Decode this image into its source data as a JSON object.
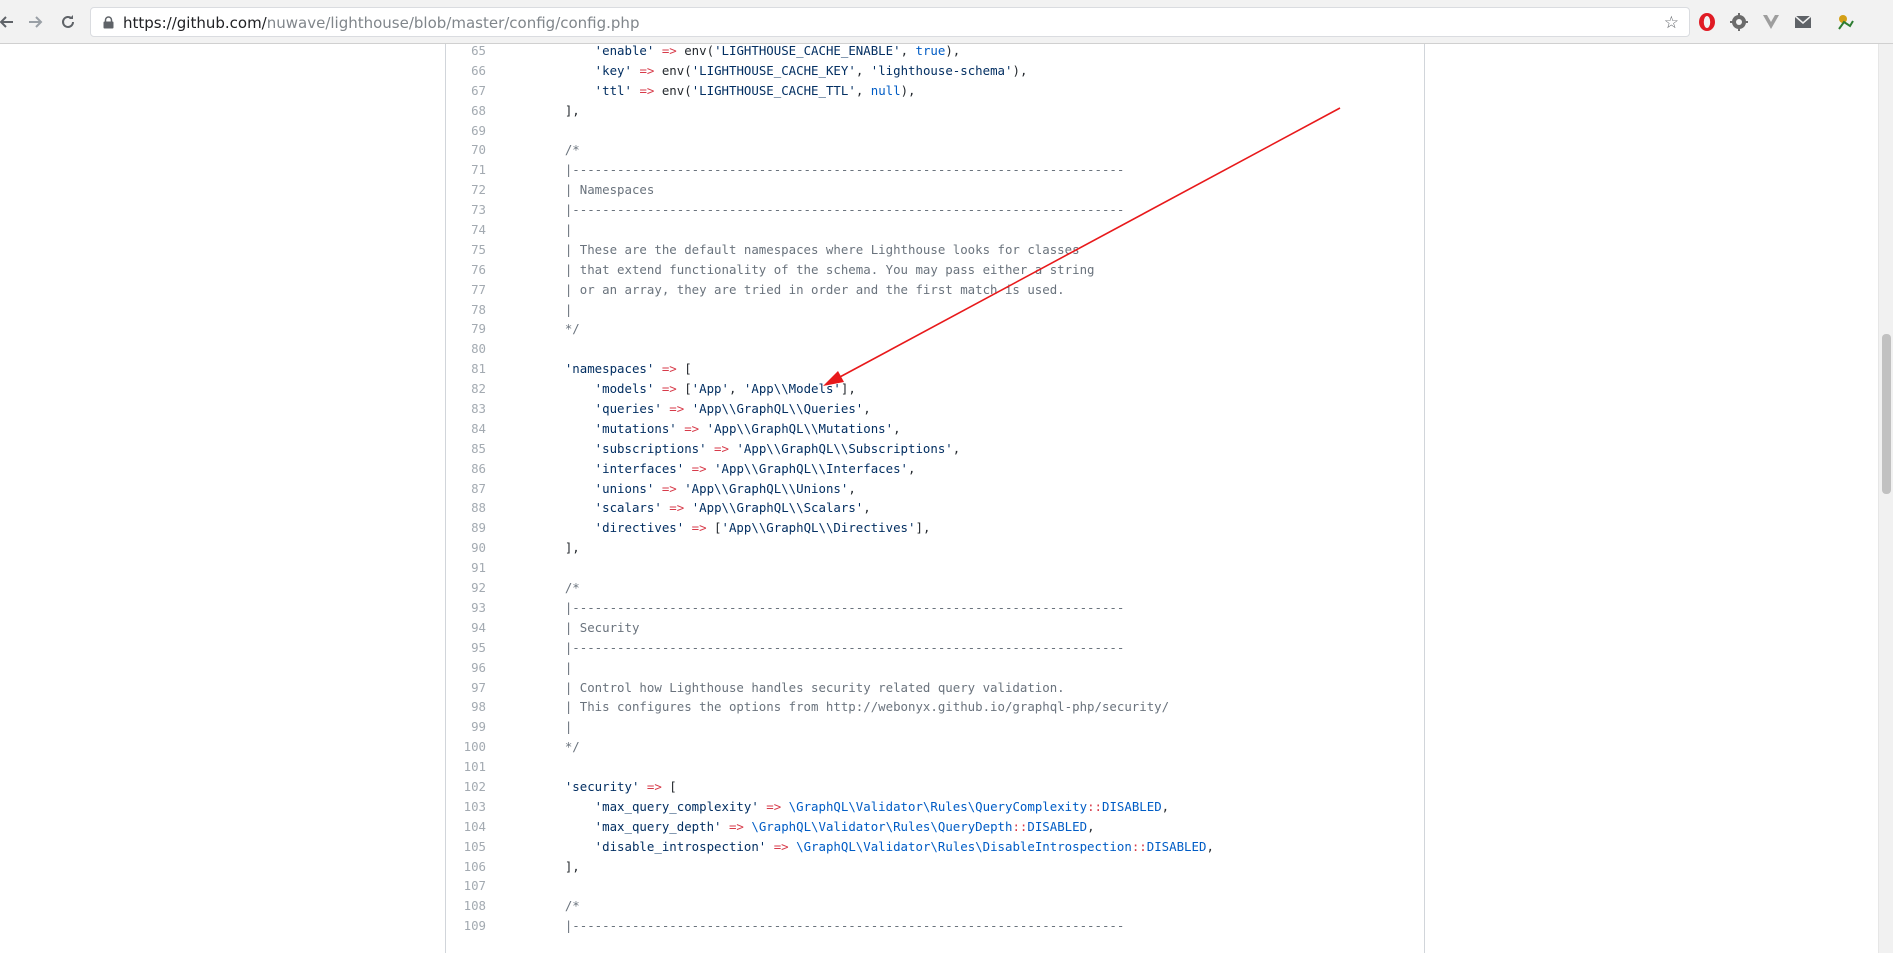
{
  "browser": {
    "url_host": "https://github.com/",
    "url_path": "nuwave/lighthouse/blob/master/config/config.php",
    "icons": [
      "back-icon",
      "forward-icon",
      "reload-icon",
      "lock-icon",
      "star-icon",
      "opera-icon",
      "gear-icon",
      "vivaldi-icon",
      "mail-icon",
      "extension-icon"
    ]
  },
  "code": {
    "lines": [
      {
        "n": "65",
        "tokens": [
          [
            "s",
            "        'enable'"
          ],
          [
            "o",
            " =>"
          ],
          [
            "p",
            " env("
          ],
          [
            "s",
            "'LIGHTHOUSE_CACHE_ENABLE'"
          ],
          [
            "p",
            ", "
          ],
          [
            "c",
            "true"
          ],
          [
            "p",
            "),"
          ]
        ]
      },
      {
        "n": "66",
        "tokens": [
          [
            "s",
            "        'key'"
          ],
          [
            "o",
            " =>"
          ],
          [
            "p",
            " env("
          ],
          [
            "s",
            "'LIGHTHOUSE_CACHE_KEY'"
          ],
          [
            "p",
            ", "
          ],
          [
            "s",
            "'lighthouse-schema'"
          ],
          [
            "p",
            "),"
          ]
        ]
      },
      {
        "n": "67",
        "tokens": [
          [
            "s",
            "        'ttl'"
          ],
          [
            "o",
            " =>"
          ],
          [
            "p",
            " env("
          ],
          [
            "s",
            "'LIGHTHOUSE_CACHE_TTL'"
          ],
          [
            "p",
            ", "
          ],
          [
            "c",
            "null"
          ],
          [
            "p",
            "),"
          ]
        ]
      },
      {
        "n": "68",
        "tokens": [
          [
            "p",
            "    ],"
          ]
        ]
      },
      {
        "n": "69",
        "tokens": []
      },
      {
        "n": "70",
        "tokens": [
          [
            "m",
            "    /*"
          ]
        ]
      },
      {
        "n": "71",
        "tokens": [
          [
            "m",
            "    |--------------------------------------------------------------------------"
          ]
        ]
      },
      {
        "n": "72",
        "tokens": [
          [
            "m",
            "    | Namespaces"
          ]
        ]
      },
      {
        "n": "73",
        "tokens": [
          [
            "m",
            "    |--------------------------------------------------------------------------"
          ]
        ]
      },
      {
        "n": "74",
        "tokens": [
          [
            "m",
            "    |"
          ]
        ]
      },
      {
        "n": "75",
        "tokens": [
          [
            "m",
            "    | These are the default namespaces where Lighthouse looks for classes"
          ]
        ]
      },
      {
        "n": "76",
        "tokens": [
          [
            "m",
            "    | that extend functionality of the schema. You may pass either a string"
          ]
        ]
      },
      {
        "n": "77",
        "tokens": [
          [
            "m",
            "    | or an array, they are tried in order and the first match is used."
          ]
        ]
      },
      {
        "n": "78",
        "tokens": [
          [
            "m",
            "    |"
          ]
        ]
      },
      {
        "n": "79",
        "tokens": [
          [
            "m",
            "    */"
          ]
        ]
      },
      {
        "n": "80",
        "tokens": []
      },
      {
        "n": "81",
        "tokens": [
          [
            "s",
            "    'namespaces'"
          ],
          [
            "o",
            " =>"
          ],
          [
            "p",
            " ["
          ]
        ]
      },
      {
        "n": "82",
        "tokens": [
          [
            "s",
            "        'models'"
          ],
          [
            "o",
            " =>"
          ],
          [
            "p",
            " ["
          ],
          [
            "s",
            "'App'"
          ],
          [
            "p",
            ", "
          ],
          [
            "s",
            "'App\\\\Models'"
          ],
          [
            "p",
            "],"
          ]
        ]
      },
      {
        "n": "83",
        "tokens": [
          [
            "s",
            "        'queries'"
          ],
          [
            "o",
            " =>"
          ],
          [
            "p",
            " "
          ],
          [
            "s",
            "'App\\\\GraphQL\\\\Queries'"
          ],
          [
            "p",
            ","
          ]
        ]
      },
      {
        "n": "84",
        "tokens": [
          [
            "s",
            "        'mutations'"
          ],
          [
            "o",
            " =>"
          ],
          [
            "p",
            " "
          ],
          [
            "s",
            "'App\\\\GraphQL\\\\Mutations'"
          ],
          [
            "p",
            ","
          ]
        ]
      },
      {
        "n": "85",
        "tokens": [
          [
            "s",
            "        'subscriptions'"
          ],
          [
            "o",
            " =>"
          ],
          [
            "p",
            " "
          ],
          [
            "s",
            "'App\\\\GraphQL\\\\Subscriptions'"
          ],
          [
            "p",
            ","
          ]
        ]
      },
      {
        "n": "86",
        "tokens": [
          [
            "s",
            "        'interfaces'"
          ],
          [
            "o",
            " =>"
          ],
          [
            "p",
            " "
          ],
          [
            "s",
            "'App\\\\GraphQL\\\\Interfaces'"
          ],
          [
            "p",
            ","
          ]
        ]
      },
      {
        "n": "87",
        "tokens": [
          [
            "s",
            "        'unions'"
          ],
          [
            "o",
            " =>"
          ],
          [
            "p",
            " "
          ],
          [
            "s",
            "'App\\\\GraphQL\\\\Unions'"
          ],
          [
            "p",
            ","
          ]
        ]
      },
      {
        "n": "88",
        "tokens": [
          [
            "s",
            "        'scalars'"
          ],
          [
            "o",
            " =>"
          ],
          [
            "p",
            " "
          ],
          [
            "s",
            "'App\\\\GraphQL\\\\Scalars'"
          ],
          [
            "p",
            ","
          ]
        ]
      },
      {
        "n": "89",
        "tokens": [
          [
            "s",
            "        'directives'"
          ],
          [
            "o",
            " =>"
          ],
          [
            "p",
            " ["
          ],
          [
            "s",
            "'App\\\\GraphQL\\\\Directives'"
          ],
          [
            "p",
            "],"
          ]
        ]
      },
      {
        "n": "90",
        "tokens": [
          [
            "p",
            "    ],"
          ]
        ]
      },
      {
        "n": "91",
        "tokens": []
      },
      {
        "n": "92",
        "tokens": [
          [
            "m",
            "    /*"
          ]
        ]
      },
      {
        "n": "93",
        "tokens": [
          [
            "m",
            "    |--------------------------------------------------------------------------"
          ]
        ]
      },
      {
        "n": "94",
        "tokens": [
          [
            "m",
            "    | Security"
          ]
        ]
      },
      {
        "n": "95",
        "tokens": [
          [
            "m",
            "    |--------------------------------------------------------------------------"
          ]
        ]
      },
      {
        "n": "96",
        "tokens": [
          [
            "m",
            "    |"
          ]
        ]
      },
      {
        "n": "97",
        "tokens": [
          [
            "m",
            "    | Control how Lighthouse handles security related query validation."
          ]
        ]
      },
      {
        "n": "98",
        "tokens": [
          [
            "m",
            "    | This configures the options from http://webonyx.github.io/graphql-php/security/"
          ]
        ]
      },
      {
        "n": "99",
        "tokens": [
          [
            "m",
            "    |"
          ]
        ]
      },
      {
        "n": "100",
        "tokens": [
          [
            "m",
            "    */"
          ]
        ]
      },
      {
        "n": "101",
        "tokens": []
      },
      {
        "n": "102",
        "tokens": [
          [
            "s",
            "    'security'"
          ],
          [
            "o",
            " =>"
          ],
          [
            "p",
            " ["
          ]
        ]
      },
      {
        "n": "103",
        "tokens": [
          [
            "s",
            "        'max_query_complexity'"
          ],
          [
            "o",
            " =>"
          ],
          [
            "p",
            " "
          ],
          [
            "c",
            "\\GraphQL\\Validator\\Rules\\QueryComplexity"
          ],
          [
            "o",
            "::"
          ],
          [
            "c",
            "DISABLED"
          ],
          [
            "p",
            ","
          ]
        ]
      },
      {
        "n": "104",
        "tokens": [
          [
            "s",
            "        'max_query_depth'"
          ],
          [
            "o",
            " =>"
          ],
          [
            "p",
            " "
          ],
          [
            "c",
            "\\GraphQL\\Validator\\Rules\\QueryDepth"
          ],
          [
            "o",
            "::"
          ],
          [
            "c",
            "DISABLED"
          ],
          [
            "p",
            ","
          ]
        ]
      },
      {
        "n": "105",
        "tokens": [
          [
            "s",
            "        'disable_introspection'"
          ],
          [
            "o",
            " =>"
          ],
          [
            "p",
            " "
          ],
          [
            "c",
            "\\GraphQL\\Validator\\Rules\\DisableIntrospection"
          ],
          [
            "o",
            "::"
          ],
          [
            "c",
            "DISABLED"
          ],
          [
            "p",
            ","
          ]
        ]
      },
      {
        "n": "106",
        "tokens": [
          [
            "p",
            "    ],"
          ]
        ]
      },
      {
        "n": "107",
        "tokens": []
      },
      {
        "n": "108",
        "tokens": [
          [
            "m",
            "    /*"
          ]
        ]
      },
      {
        "n": "109",
        "tokens": [
          [
            "m",
            "    |--------------------------------------------------------------------------"
          ]
        ]
      }
    ]
  },
  "colors": {
    "string": "#032f62",
    "operator": "#d73a49",
    "comment": "#6a737d",
    "constant": "#005cc5",
    "annotation_arrow": "#e8191b"
  }
}
